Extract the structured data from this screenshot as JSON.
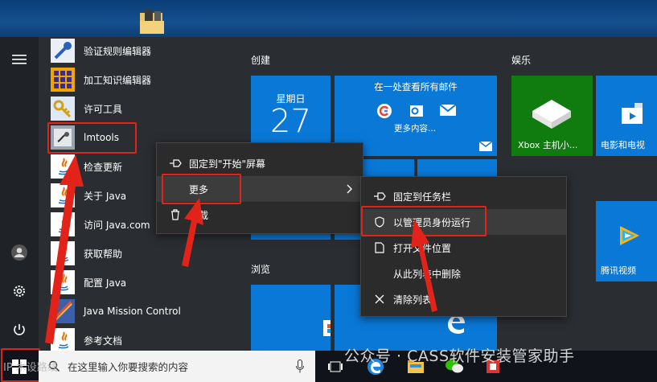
{
  "apps": [
    {
      "label": "验证规则编辑器",
      "icon": "tool-icon"
    },
    {
      "label": "加工知识编辑器",
      "icon": "grid-icon"
    },
    {
      "label": "许可工具",
      "icon": "key-icon"
    },
    {
      "label": "lmtools",
      "icon": "lmtools-icon"
    },
    {
      "label": "检查更新",
      "icon": "java-icon"
    },
    {
      "label": "关于 Java",
      "icon": "java-icon"
    },
    {
      "label": "访问 Java.com",
      "icon": "java-icon"
    },
    {
      "label": "获取帮助",
      "icon": "java-icon"
    },
    {
      "label": "配置 Java",
      "icon": "java-icon"
    },
    {
      "label": "Java Mission Control",
      "icon": "mission-control-icon"
    },
    {
      "label": "参考文档",
      "icon": "java-icon"
    }
  ],
  "groups": {
    "create": "创建",
    "entertain": "娱乐",
    "browse": "浏览"
  },
  "tiles": {
    "calendar": {
      "weekday": "星期日",
      "day": "27"
    },
    "mail": {
      "title": "在一处查看所有邮件",
      "more": "更多内容..."
    },
    "xbox": {
      "label": "Xbox 主机小..."
    },
    "movies": {
      "label": "电影和电视"
    },
    "tencent": {
      "label": "腾讯视频"
    }
  },
  "context_menu": {
    "pin_start": "固定到\"开始\"屏幕",
    "more": "更多",
    "uninstall": "卸载"
  },
  "submenu": {
    "pin_taskbar": "固定到任务栏",
    "run_admin": "以管理员身份运行",
    "open_location": "打开文件位置",
    "remove_list": "从此列表中删除",
    "clear_list": "清除列表"
  },
  "taskbar": {
    "search_placeholder": "在这里输入你要搜索的内容"
  },
  "watermark": "公众号 · CASS软件安装管家助手",
  "watermark_small": "IP 木设路线",
  "colors": {
    "tile_blue": "#0a78d7",
    "xbox_green": "#107c10",
    "highlight_red": "#e2231a",
    "menu_bg": "#2b2b2b"
  }
}
